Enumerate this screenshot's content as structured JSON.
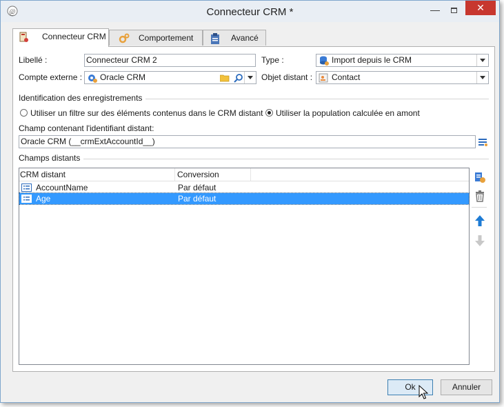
{
  "window": {
    "title": "Connecteur CRM *",
    "minimize": "—",
    "close": "✕"
  },
  "tabs": [
    {
      "label": "Connecteur CRM",
      "icon": "crm-connector-icon",
      "active": true
    },
    {
      "label": "Comportement",
      "icon": "gears-icon",
      "active": false
    },
    {
      "label": "Avancé",
      "icon": "clipboard-icon",
      "active": false
    }
  ],
  "form": {
    "libelle_label": "Libellé :",
    "libelle_value": "Connecteur CRM 2",
    "type_label": "Type :",
    "type_value": "Import depuis le CRM",
    "compte_label": "Compte externe :",
    "compte_value": "Oracle CRM",
    "objet_label": "Objet distant :",
    "objet_value": "Contact"
  },
  "identification": {
    "title": "Identification des enregistrements",
    "radio1": "Utiliser un filtre sur des éléments contenus dans le CRM distant",
    "radio2": "Utiliser la population calculée en amont",
    "selected": "radio2",
    "champ_label": "Champ contenant l'identifiant distant:",
    "champ_value": "Oracle CRM (__crmExtAccountId__)"
  },
  "champs": {
    "title": "Champs distants",
    "columns": [
      "CRM distant",
      "Conversion"
    ],
    "rows": [
      {
        "name": "AccountName",
        "conversion": "Par défaut",
        "selected": false
      },
      {
        "name": "Age",
        "conversion": "Par défaut",
        "selected": true
      }
    ]
  },
  "buttons": {
    "ok": "Ok",
    "cancel": "Annuler"
  },
  "colors": {
    "selection": "#3399ff",
    "close": "#c7372f",
    "accent": "#1e7bd4"
  }
}
